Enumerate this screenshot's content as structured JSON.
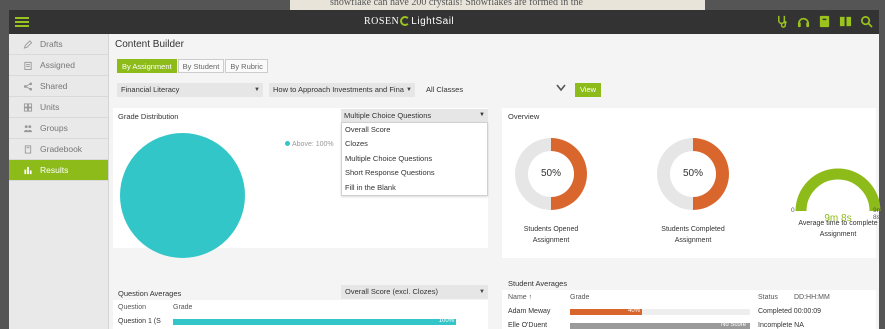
{
  "background_text": "snowflake can have 200 crystals! Snowflakes are formed in the",
  "brand": {
    "rosen": "ROSEN",
    "light": "LightSail"
  },
  "topbar_icons": [
    "stethoscope-icon",
    "headphones-icon",
    "book-icon",
    "library-icon",
    "search-icon"
  ],
  "sidebar": {
    "items": [
      {
        "label": "Drafts",
        "icon": "pencil-icon",
        "active": false
      },
      {
        "label": "Assigned",
        "icon": "clipboard-icon",
        "active": false
      },
      {
        "label": "Shared",
        "icon": "share-icon",
        "active": false
      },
      {
        "label": "Units",
        "icon": "units-icon",
        "active": false
      },
      {
        "label": "Groups",
        "icon": "groups-icon",
        "active": false
      },
      {
        "label": "Gradebook",
        "icon": "gradebook-icon",
        "active": false
      },
      {
        "label": "Results",
        "icon": "bar-chart-icon",
        "active": true
      }
    ]
  },
  "main": {
    "title": "Content Builder",
    "tabs": [
      "By Assignment",
      "By Student",
      "By Rubric"
    ],
    "filters": {
      "content": "Financial Literacy",
      "assignment": "How to Approach Investments and Fina",
      "classes": "All Classes",
      "view_label": "View"
    }
  },
  "grade_distribution": {
    "label": "Grade Distribution",
    "dropdown_value": "Multiple Choice Questions",
    "options": [
      "Overall Score",
      "Clozes",
      "Multiple Choice Questions",
      "Short Response Questions",
      "Fill in the Blank"
    ],
    "legend": "Above: 100%"
  },
  "overview": {
    "label": "Overview",
    "opened": {
      "value": "50%",
      "fraction": 0.5,
      "caption": "Students Opened Assignment"
    },
    "completed": {
      "value": "50%",
      "fraction": 0.5,
      "caption": "Students Completed Assignment"
    },
    "avg_time": {
      "value": "9m 8s",
      "min": "0",
      "max": "9m 8s",
      "caption": "Average time to complete Assignment"
    }
  },
  "question_averages": {
    "label": "Question Averages",
    "dropdown_value": "Overall Score (excl. Clozes)",
    "columns": [
      "Question",
      "Grade"
    ],
    "rows": [
      {
        "question": "Question 1 (S",
        "grade": "100%",
        "fraction": 1.0
      }
    ]
  },
  "student_averages": {
    "label": "Student Averages",
    "columns": [
      "Name ↑",
      "Grade",
      "Status",
      "DD:HH:MM"
    ],
    "rows": [
      {
        "name": "Adam Meway",
        "grade": "40%",
        "fraction": 0.4,
        "status": "Completed 00:00:09"
      },
      {
        "name": "Elle O'Duent",
        "grade": "No Score",
        "fraction": 0,
        "status": "Incomplete NA"
      }
    ]
  },
  "colors": {
    "accent": "#8dbb1a",
    "teal": "#33c6c9",
    "orange": "#d9672d",
    "bar_grey": "#9a9a9a"
  }
}
